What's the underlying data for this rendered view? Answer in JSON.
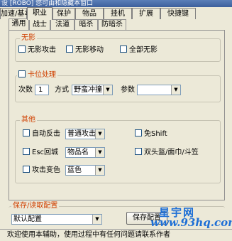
{
  "window": {
    "title": "设 [ROBO] 您可由和隐藏本窗口"
  },
  "top_tabs": [
    "加速/基本",
    "职业",
    "保护",
    "物品",
    "挂机",
    "扩展",
    "快捷键"
  ],
  "sub_tabs": [
    "通用",
    "战士",
    "法道",
    "暗杀",
    "防暗杀"
  ],
  "no_shadow": {
    "title": "无影",
    "options": [
      "无影攻击",
      "无影移动",
      "全部无影"
    ]
  },
  "stuck": {
    "title": "卡位处理",
    "count_label": "次数",
    "count_value": "1",
    "mode_label": "方式",
    "mode_value": "野蛮冲撞",
    "param_label": "参数",
    "param_value": ""
  },
  "other": {
    "title": "其他",
    "auto_counter_label": "自动反击",
    "auto_counter_value": "普通攻击",
    "esc_return_label": "Esc回城",
    "esc_return_value": "物品名",
    "attack_color_label": "攻击变色",
    "attack_color_value": "蓝色",
    "free_shift_label": "免Shift",
    "double_head_label": "双头盔/面巾/斗笠"
  },
  "config": {
    "title": "保存/读取配置",
    "selected": "默认配置",
    "save_label": "保存配置"
  },
  "status_text": "欢迎使用本辅助，使用过程中有任何问题请联系作者",
  "watermark": {
    "text_cn": "星宇网",
    "url": "www.93hq.com"
  }
}
